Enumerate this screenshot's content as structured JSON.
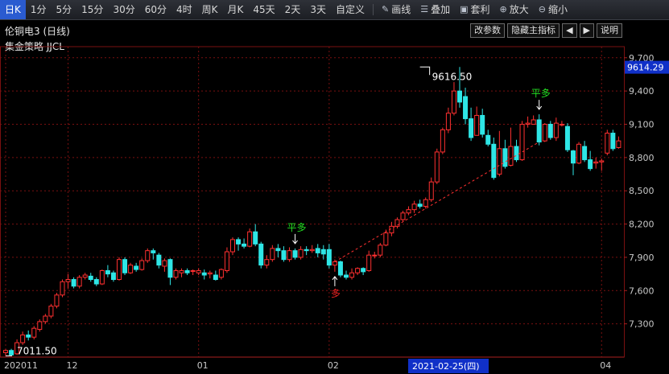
{
  "toolbar": {
    "periods": [
      "日K",
      "1分",
      "5分",
      "15分",
      "30分",
      "60分",
      "4时",
      "周K",
      "月K",
      "45天",
      "2天",
      "3天",
      "自定义"
    ],
    "active_period": "日K",
    "tools": [
      {
        "icon": "pencil-icon",
        "label": "画线"
      },
      {
        "icon": "stack-icon",
        "label": "叠加"
      },
      {
        "icon": "briefcase-icon",
        "label": "套利"
      },
      {
        "icon": "zoom-in-icon",
        "label": "放大"
      },
      {
        "icon": "zoom-out-icon",
        "label": "缩小"
      }
    ]
  },
  "chart_title": "伦铜电3 (日线)",
  "strategy_label": "集金策略 JJCL",
  "title_buttons": [
    "改参数",
    "隐藏主指标",
    "◀",
    "▶",
    "说明"
  ],
  "price_tag": "9614.29",
  "crosshair_date": "2021-02-25(四)",
  "annotations": {
    "high_label": "9616.50",
    "low_label": "7011.50",
    "signal_close1": "平多",
    "signal_close2": "平多",
    "signal_long": "多"
  },
  "colors": {
    "up": "#ff3030",
    "down": "#2ee6e6",
    "grid": "#7a1010",
    "signal_green": "#22dd22",
    "signal_red": "#ee2222"
  },
  "chart_data": {
    "type": "candlestick",
    "ylim": [
      7000,
      9800
    ],
    "y_ticks": [
      7300,
      7600,
      7900,
      8200,
      8500,
      8800,
      9100,
      9400,
      9700
    ],
    "x_tick_labels": [
      {
        "index": 0,
        "label": "202011"
      },
      {
        "index": 11,
        "label": "12"
      },
      {
        "index": 34,
        "label": "01"
      },
      {
        "index": 57,
        "label": "02"
      },
      {
        "index": 105,
        "label": "04"
      }
    ],
    "candles": [
      [
        7040,
        7060,
        7011.5,
        7070
      ],
      [
        7060,
        7020,
        7011.5,
        7075
      ],
      [
        7030,
        7130,
        7020,
        7160
      ],
      [
        7130,
        7200,
        7110,
        7230
      ],
      [
        7200,
        7180,
        7150,
        7240
      ],
      [
        7180,
        7260,
        7160,
        7280
      ],
      [
        7250,
        7320,
        7230,
        7340
      ],
      [
        7320,
        7370,
        7300,
        7390
      ],
      [
        7370,
        7460,
        7350,
        7480
      ],
      [
        7460,
        7560,
        7440,
        7580
      ],
      [
        7560,
        7680,
        7540,
        7700
      ],
      [
        7680,
        7700,
        7620,
        7750
      ],
      [
        7700,
        7640,
        7620,
        7720
      ],
      [
        7640,
        7720,
        7620,
        7740
      ],
      [
        7720,
        7740,
        7700,
        7760
      ],
      [
        7730,
        7700,
        7680,
        7760
      ],
      [
        7700,
        7660,
        7640,
        7720
      ],
      [
        7660,
        7780,
        7650,
        7790
      ],
      [
        7780,
        7750,
        7720,
        7830
      ],
      [
        7760,
        7700,
        7680,
        7780
      ],
      [
        7700,
        7880,
        7690,
        7900
      ],
      [
        7880,
        7760,
        7740,
        7900
      ],
      [
        7760,
        7830,
        7750,
        7850
      ],
      [
        7820,
        7790,
        7770,
        7850
      ],
      [
        7790,
        7870,
        7780,
        7890
      ],
      [
        7870,
        7960,
        7850,
        7980
      ],
      [
        7960,
        7940,
        7880,
        7980
      ],
      [
        7920,
        7830,
        7800,
        7940
      ],
      [
        7820,
        7870,
        7770,
        7890
      ],
      [
        7880,
        7720,
        7650,
        7890
      ],
      [
        7720,
        7780,
        7700,
        7800
      ],
      [
        7760,
        7780,
        7720,
        7800
      ],
      [
        7780,
        7760,
        7740,
        7800
      ],
      [
        7780,
        7780,
        7740,
        7790
      ],
      [
        7760,
        7780,
        7740,
        7800
      ],
      [
        7760,
        7740,
        7700,
        7790
      ],
      [
        7750,
        7760,
        7710,
        7780
      ],
      [
        7740,
        7700,
        7690,
        7780
      ],
      [
        7720,
        7790,
        7700,
        7800
      ],
      [
        7780,
        7950,
        7760,
        7990
      ],
      [
        7950,
        8060,
        7920,
        8080
      ],
      [
        8060,
        8020,
        7960,
        8080
      ],
      [
        8020,
        8000,
        7980,
        8070
      ],
      [
        8000,
        8130,
        7990,
        8160
      ],
      [
        8130,
        8020,
        8000,
        8200
      ],
      [
        8020,
        7830,
        7800,
        8040
      ],
      [
        7830,
        7880,
        7800,
        7920
      ],
      [
        7880,
        7980,
        7860,
        8010
      ],
      [
        7980,
        7960,
        7900,
        8020
      ],
      [
        7960,
        7880,
        7860,
        8000
      ],
      [
        7880,
        7960,
        7860,
        7990
      ],
      [
        7960,
        7900,
        7880,
        7980
      ],
      [
        7900,
        7970,
        7880,
        8000
      ],
      [
        7970,
        7960,
        7920,
        8000
      ],
      [
        7960,
        7970,
        7940,
        8010
      ],
      [
        7980,
        7940,
        7900,
        8020
      ],
      [
        7970,
        7930,
        7880,
        8010
      ],
      [
        7970,
        7830,
        7800,
        8020
      ],
      [
        7830,
        7860,
        7770,
        7880
      ],
      [
        7860,
        7740,
        7720,
        7870
      ],
      [
        7740,
        7720,
        7700,
        7780
      ],
      [
        7720,
        7760,
        7700,
        7800
      ],
      [
        7760,
        7800,
        7740,
        7810
      ],
      [
        7800,
        7770,
        7740,
        7810
      ],
      [
        7780,
        7920,
        7770,
        7960
      ],
      [
        7920,
        7920,
        7890,
        7950
      ],
      [
        7920,
        8010,
        7900,
        8030
      ],
      [
        8010,
        8120,
        8000,
        8150
      ],
      [
        8120,
        8180,
        8090,
        8220
      ],
      [
        8180,
        8240,
        8160,
        8260
      ],
      [
        8240,
        8300,
        8220,
        8320
      ],
      [
        8300,
        8330,
        8280,
        8360
      ],
      [
        8330,
        8380,
        8300,
        8410
      ],
      [
        8380,
        8360,
        8340,
        8420
      ],
      [
        8360,
        8420,
        8340,
        8440
      ],
      [
        8420,
        8580,
        8400,
        8620
      ],
      [
        8580,
        8850,
        8560,
        8880
      ],
      [
        8850,
        9050,
        8830,
        9070
      ],
      [
        9050,
        9200,
        9020,
        9250
      ],
      [
        9200,
        9400,
        9180,
        9480
      ],
      [
        9400,
        9300,
        9250,
        9616.5
      ],
      [
        9350,
        9150,
        9100,
        9430
      ],
      [
        9150,
        8980,
        8950,
        9250
      ],
      [
        9000,
        9180,
        9000,
        9260
      ],
      [
        9180,
        9010,
        8980,
        9240
      ],
      [
        9000,
        8920,
        8900,
        9050
      ],
      [
        8920,
        8620,
        8600,
        8980
      ],
      [
        8650,
        8880,
        8630,
        9040
      ],
      [
        8880,
        8720,
        8700,
        8960
      ],
      [
        8730,
        8900,
        8720,
        9070
      ],
      [
        8900,
        8780,
        8760,
        8960
      ],
      [
        8780,
        9100,
        8770,
        9130
      ],
      [
        9100,
        9110,
        9070,
        9170
      ],
      [
        9100,
        9140,
        9100,
        9180
      ],
      [
        9140,
        8940,
        8910,
        9190
      ],
      [
        8950,
        9100,
        8940,
        9110
      ],
      [
        9100,
        8980,
        8960,
        9130
      ],
      [
        8980,
        9110,
        8950,
        9160
      ],
      [
        9100,
        9100,
        9080,
        9130
      ],
      [
        9080,
        8870,
        8850,
        9110
      ],
      [
        8860,
        8750,
        8640,
        8870
      ],
      [
        8750,
        8920,
        8740,
        8940
      ],
      [
        8900,
        8780,
        8760,
        8950
      ],
      [
        8780,
        8700,
        8680,
        8860
      ],
      [
        8750,
        8760,
        8700,
        8800
      ],
      [
        8760,
        8770,
        8680,
        8790
      ],
      [
        8840,
        9020,
        8820,
        9050
      ],
      [
        9020,
        8880,
        8860,
        9050
      ],
      [
        8890,
        8950,
        8880,
        8990
      ]
    ],
    "signals": [
      {
        "index": 51,
        "type": "平多"
      },
      {
        "index": 58,
        "type": "多"
      },
      {
        "index": 94,
        "type": "平多"
      }
    ],
    "high_point": {
      "index": 73,
      "value": 9616.5
    },
    "low_point": {
      "index": 0,
      "value": 7011.5
    }
  }
}
